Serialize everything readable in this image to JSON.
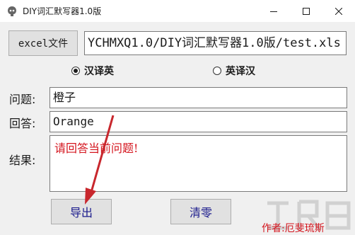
{
  "window": {
    "title": "DIY词汇默写器1.0版",
    "controls": [
      "minimize",
      "maximize",
      "close"
    ]
  },
  "toolbar": {
    "excel_button_label": "excel文件",
    "path_value": "YCHMXQ1.0/DIY词汇默写器1.0版/test.xls"
  },
  "mode": {
    "options": [
      {
        "label": "汉译英",
        "selected": true
      },
      {
        "label": "英译汉",
        "selected": false
      }
    ]
  },
  "form": {
    "question_label": "问题:",
    "question_value": "橙子",
    "answer_label": "回答:",
    "answer_value": "Orange",
    "result_label": "结果:",
    "result_value": "请回答当前问题!"
  },
  "actions": {
    "export_label": "导出",
    "clear_label": "清零"
  },
  "footer": {
    "author": "作者:厄斐琉斯"
  },
  "colors": {
    "result_text": "#d4141d",
    "button_text": "#1a1a8c",
    "arrow": "#c8272d"
  }
}
